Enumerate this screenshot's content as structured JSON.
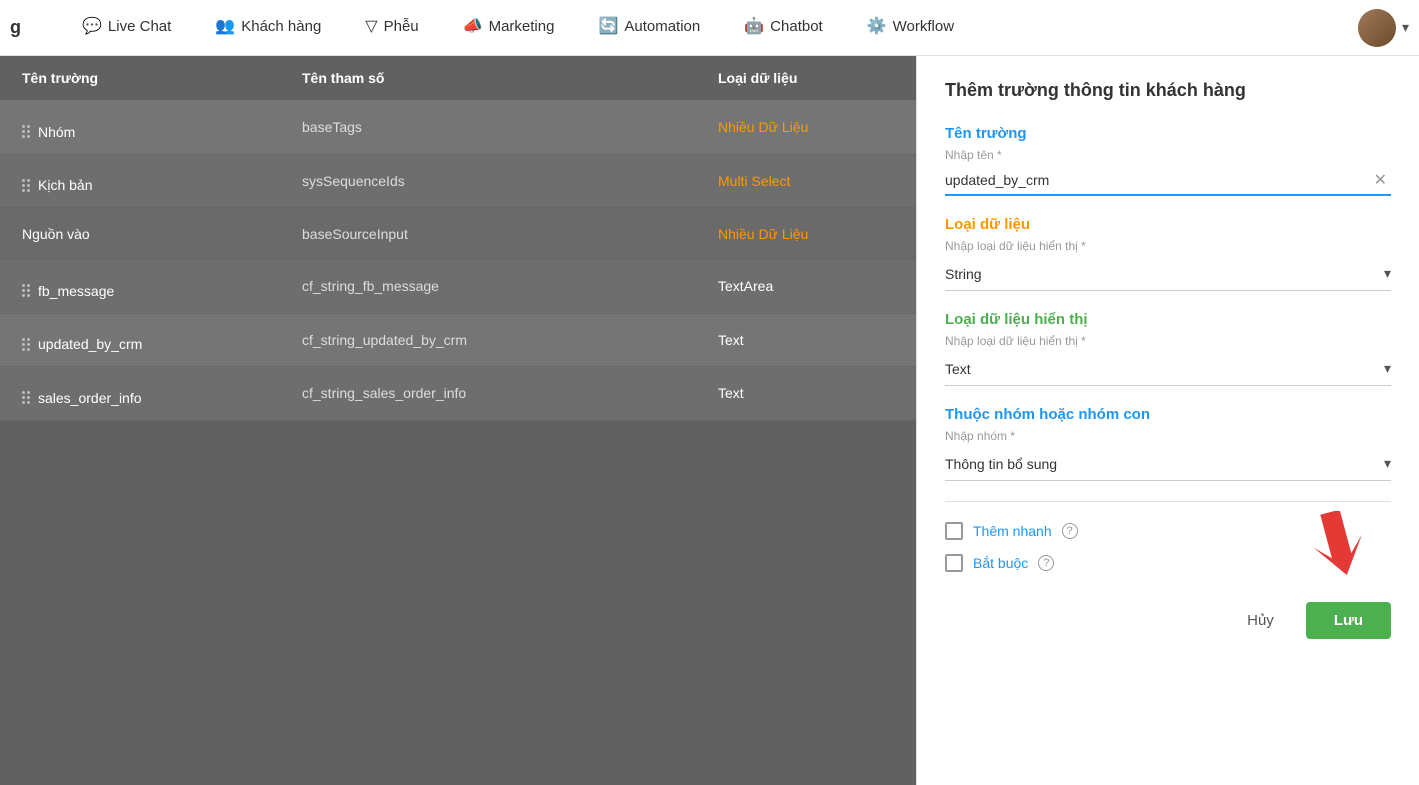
{
  "header": {
    "logo": "g",
    "nav": [
      {
        "id": "live-chat",
        "label": "Live Chat",
        "icon": "💬"
      },
      {
        "id": "khach-hang",
        "label": "Khách hàng",
        "icon": "👥"
      },
      {
        "id": "pheu",
        "label": "Phễu",
        "icon": "🔽"
      },
      {
        "id": "marketing",
        "label": "Marketing",
        "icon": "📣"
      },
      {
        "id": "automation",
        "label": "Automation",
        "icon": "🔄"
      },
      {
        "id": "chatbot",
        "label": "Chatbot",
        "icon": "🤖"
      },
      {
        "id": "workflow",
        "label": "Workflow",
        "icon": "⚙️"
      }
    ]
  },
  "table": {
    "columns": [
      "Tên trường",
      "Tên tham số",
      "Loại dữ liệu"
    ],
    "rows": [
      {
        "name": "Nhóm",
        "param": "baseTags",
        "type": "Nhiều Dữ Liệu",
        "hasDrag": true
      },
      {
        "name": "Kịch bản",
        "param": "sysSequenceIds",
        "type": "Multi Select",
        "hasDrag": true
      },
      {
        "name": "Nguồn vào",
        "param": "baseSourceInput",
        "type": "Nhiều Dữ Liệu",
        "hasDrag": false
      },
      {
        "name": "fb_message",
        "param": "cf_string_fb_message",
        "type": "TextArea",
        "hasDrag": true
      },
      {
        "name": "updated_by_crm",
        "param": "cf_string_updated_by_crm",
        "type": "Text",
        "hasDrag": true
      },
      {
        "name": "sales_order_info",
        "param": "cf_string_sales_order_info",
        "type": "Text",
        "hasDrag": true
      }
    ]
  },
  "panel": {
    "title": "Thêm trường thông tin khách hàng",
    "field_ten_truong": {
      "label": "Tên trường",
      "sublabel": "Nhập tên *",
      "value": "updated_by_crm"
    },
    "field_loai_du_lieu": {
      "label": "Loại dữ liệu",
      "sublabel": "Nhập loại dữ liệu hiển thị *",
      "value": "String"
    },
    "field_loai_du_lieu_hien_thi": {
      "label": "Loại dữ liệu hiển thị",
      "sublabel": "Nhập loại dữ liệu hiển thị *",
      "value": "Text"
    },
    "field_nhom": {
      "label": "Thuộc nhóm hoặc nhóm con",
      "sublabel": "Nhập nhóm *",
      "value": "Thông tin bổ sung"
    },
    "them_nhanh": {
      "label": "Thêm nhanh",
      "checked": false
    },
    "bat_buoc": {
      "label": "Bắt buộc",
      "checked": false
    },
    "btn_cancel": "Hủy",
    "btn_save": "Lưu"
  }
}
